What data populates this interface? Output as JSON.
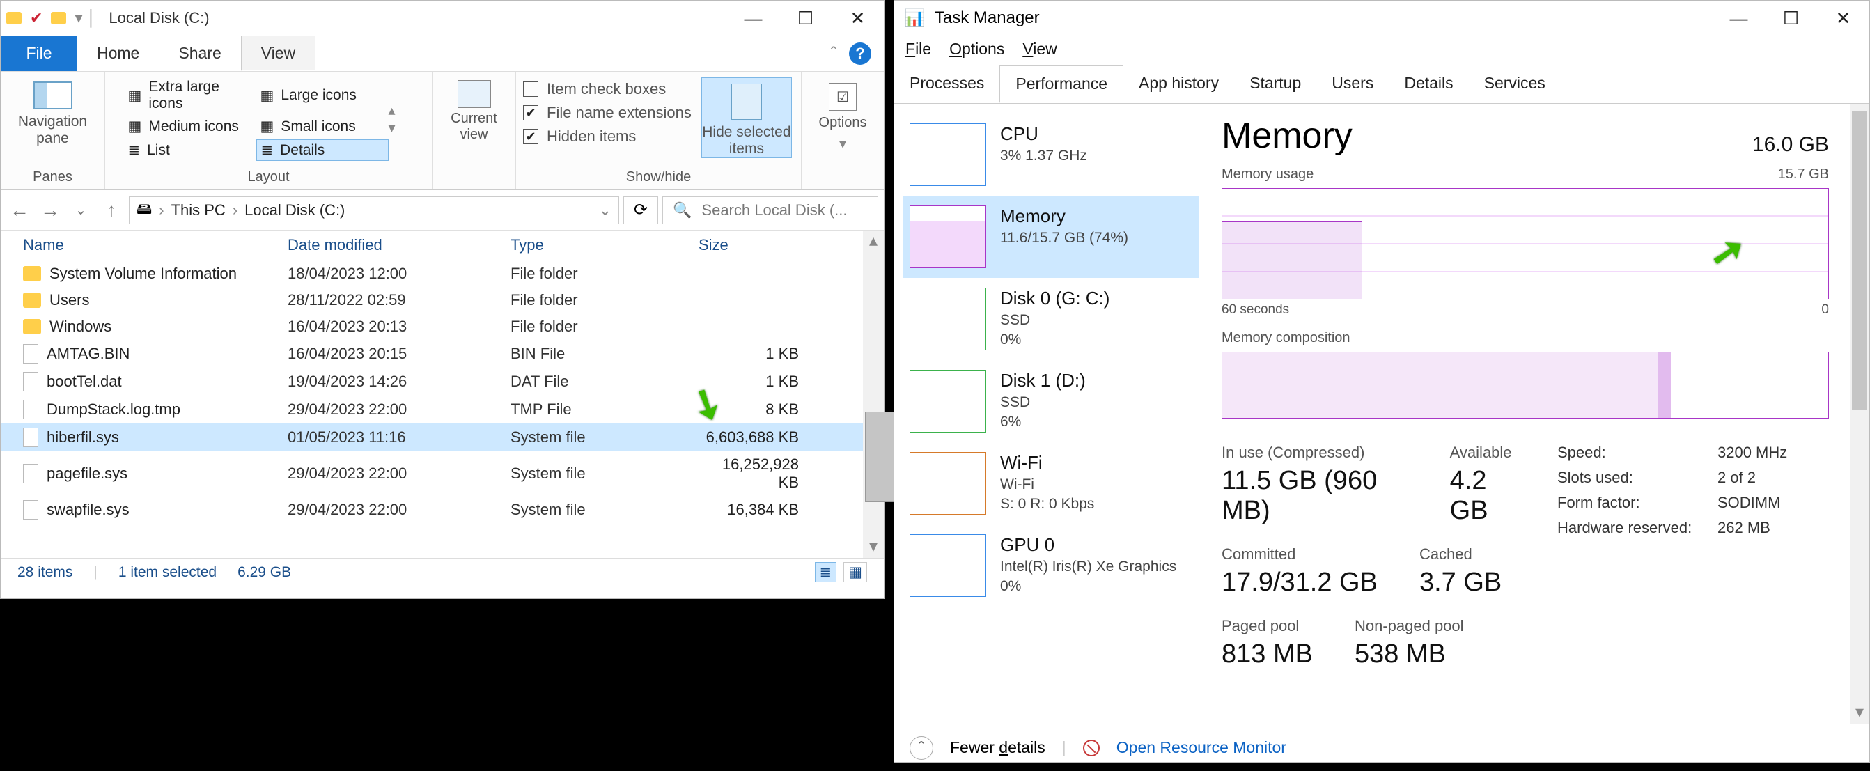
{
  "explorer": {
    "title": "Local Disk (C:)",
    "tabs": {
      "file": "File",
      "home": "Home",
      "share": "Share",
      "view": "View"
    },
    "ribbon": {
      "panes_group": "Panes",
      "nav_pane": "Navigation\npane",
      "layout_group": "Layout",
      "layout_items": [
        "Extra large icons",
        "Large icons",
        "Medium icons",
        "Small icons",
        "List",
        "Details"
      ],
      "current_view": "Current\nview",
      "showhide_group": "Show/hide",
      "chk_item_boxes": "Item check boxes",
      "chk_ext": "File name extensions",
      "chk_hidden": "Hidden items",
      "hide_selected": "Hide selected\nitems",
      "options": "Options"
    },
    "breadcrumb": {
      "root": "This PC",
      "leaf": "Local Disk (C:)"
    },
    "search_placeholder": "Search Local Disk (...",
    "columns": {
      "name": "Name",
      "date": "Date modified",
      "type": "Type",
      "size": "Size"
    },
    "rows": [
      {
        "icon": "folder",
        "name": "System Volume Information",
        "date": "18/04/2023 12:00",
        "type": "File folder",
        "size": ""
      },
      {
        "icon": "folder",
        "name": "Users",
        "date": "28/11/2022 02:59",
        "type": "File folder",
        "size": ""
      },
      {
        "icon": "folder",
        "name": "Windows",
        "date": "16/04/2023 20:13",
        "type": "File folder",
        "size": ""
      },
      {
        "icon": "file",
        "name": "AMTAG.BIN",
        "date": "16/04/2023 20:15",
        "type": "BIN File",
        "size": "1 KB"
      },
      {
        "icon": "file",
        "name": "bootTel.dat",
        "date": "19/04/2023 14:26",
        "type": "DAT File",
        "size": "1 KB"
      },
      {
        "icon": "file",
        "name": "DumpStack.log.tmp",
        "date": "29/04/2023 22:00",
        "type": "TMP File",
        "size": "8 KB"
      },
      {
        "icon": "file",
        "name": "hiberfil.sys",
        "date": "01/05/2023 11:16",
        "type": "System file",
        "size": "6,603,688 KB",
        "selected": true
      },
      {
        "icon": "file",
        "name": "pagefile.sys",
        "date": "29/04/2023 22:00",
        "type": "System file",
        "size": "16,252,928 KB"
      },
      {
        "icon": "file",
        "name": "swapfile.sys",
        "date": "29/04/2023 22:00",
        "type": "System file",
        "size": "16,384 KB"
      }
    ],
    "status": {
      "items": "28 items",
      "selected": "1 item selected",
      "size": "6.29 GB"
    }
  },
  "tm": {
    "title": "Task Manager",
    "menu": [
      "File",
      "Options",
      "View"
    ],
    "tabs": [
      "Processes",
      "Performance",
      "App history",
      "Startup",
      "Users",
      "Details",
      "Services"
    ],
    "active_tab": "Performance",
    "cards": [
      {
        "title": "CPU",
        "sub": "3%  1.37 GHz",
        "color": "#3a8be8"
      },
      {
        "title": "Memory",
        "sub": "11.6/15.7 GB (74%)",
        "color": "#a836c7",
        "selected": true
      },
      {
        "title": "Disk 0 (G: C:)",
        "sub": "SSD",
        "sub2": "0%",
        "color": "#3bb24c"
      },
      {
        "title": "Disk 1 (D:)",
        "sub": "SSD",
        "sub2": "6%",
        "color": "#3bb24c"
      },
      {
        "title": "Wi-Fi",
        "sub": "Wi-Fi",
        "sub2": "S: 0 R: 0 Kbps",
        "color": "#d67a2a"
      },
      {
        "title": "GPU 0",
        "sub": "Intel(R) Iris(R) Xe Graphics",
        "sub2": "0%",
        "color": "#3a8be8"
      }
    ],
    "mem": {
      "heading": "Memory",
      "total": "16.0 GB",
      "usage_label": "Memory usage",
      "usage_max": "15.7 GB",
      "axis_left": "60 seconds",
      "axis_right": "0",
      "comp_label": "Memory composition",
      "inuse_lab": "In use (Compressed)",
      "inuse_val": "11.5 GB (960 MB)",
      "avail_lab": "Available",
      "avail_val": "4.2 GB",
      "committed_lab": "Committed",
      "committed_val": "17.9/31.2 GB",
      "cached_lab": "Cached",
      "cached_val": "3.7 GB",
      "paged_lab": "Paged pool",
      "paged_val": "813 MB",
      "nonpaged_lab": "Non-paged pool",
      "nonpaged_val": "538 MB",
      "speed_lab": "Speed:",
      "speed_val": "3200 MHz",
      "slots_lab": "Slots used:",
      "slots_val": "2 of 2",
      "form_lab": "Form factor:",
      "form_val": "SODIMM",
      "hw_lab": "Hardware reserved:",
      "hw_val": "262 MB"
    },
    "footer": {
      "fewer": "Fewer details",
      "orm": "Open Resource Monitor"
    }
  }
}
